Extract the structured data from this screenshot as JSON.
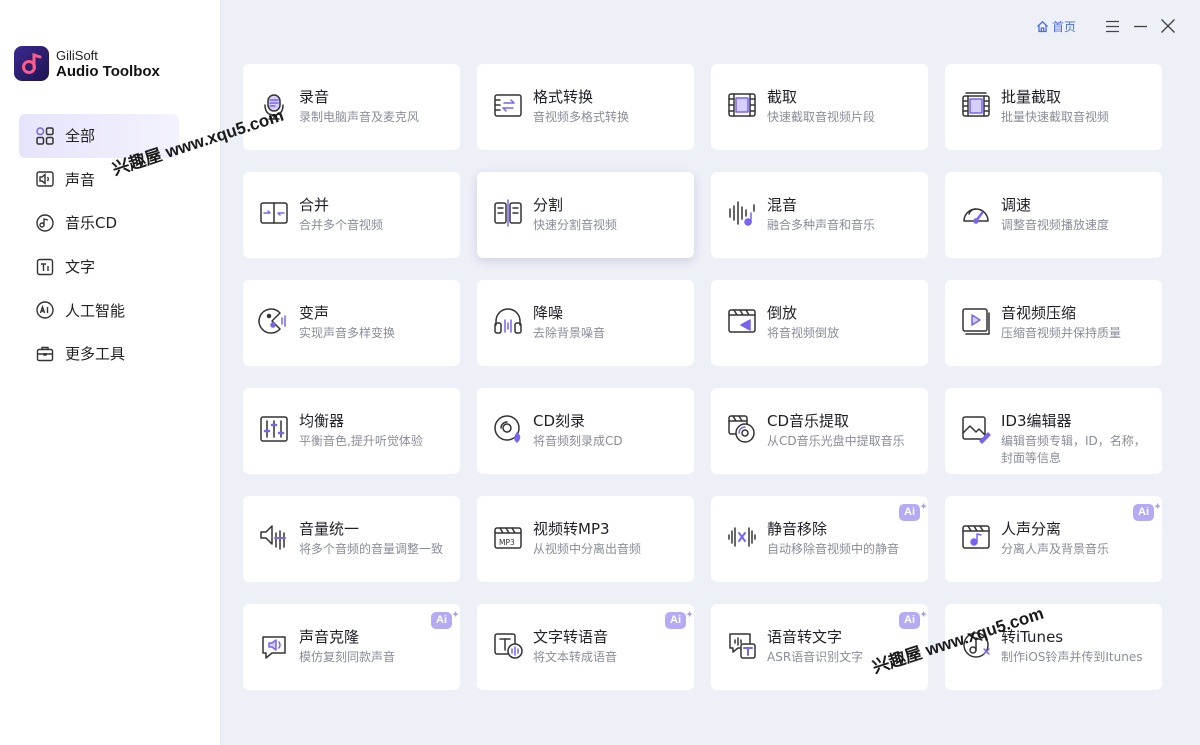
{
  "app": {
    "brand_line1": "GiliSoft",
    "brand_line2": "Audio Toolbox"
  },
  "topbar": {
    "home_label": "首页"
  },
  "sidebar": {
    "items": [
      {
        "label": "全部",
        "icon": "grid-icon",
        "active": true
      },
      {
        "label": "声音",
        "icon": "speaker-icon"
      },
      {
        "label": "音乐CD",
        "icon": "music-cd-icon"
      },
      {
        "label": "文字",
        "icon": "text-icon"
      },
      {
        "label": "人工智能",
        "icon": "ai-icon"
      },
      {
        "label": "更多工具",
        "icon": "toolbox-icon"
      }
    ]
  },
  "tools": [
    {
      "title": "录音",
      "desc": "录制电脑声音及麦克风",
      "icon": "microphone-icon"
    },
    {
      "title": "格式转换",
      "desc": "音视频多格式转换",
      "icon": "convert-icon"
    },
    {
      "title": "截取",
      "desc": "快速截取音视频片段",
      "icon": "film-trim-icon"
    },
    {
      "title": "批量截取",
      "desc": "批量快速截取音视频",
      "icon": "batch-trim-icon"
    },
    {
      "title": "合并",
      "desc": "合并多个音视频",
      "icon": "merge-icon"
    },
    {
      "title": "分割",
      "desc": "快速分割音视频",
      "icon": "split-icon"
    },
    {
      "title": "混音",
      "desc": "融合多种声音和音乐",
      "icon": "mix-icon"
    },
    {
      "title": "调速",
      "desc": "调整音视频播放速度",
      "icon": "speedometer-icon"
    },
    {
      "title": "变声",
      "desc": "实现声音多样变换",
      "icon": "voice-change-icon"
    },
    {
      "title": "降噪",
      "desc": "去除背景噪音",
      "icon": "headphones-icon"
    },
    {
      "title": "倒放",
      "desc": "将音视频倒放",
      "icon": "reverse-icon"
    },
    {
      "title": "音视频压缩",
      "desc": "压缩音视频并保持质量",
      "icon": "compress-icon"
    },
    {
      "title": "均衡器",
      "desc": "平衡音色,提升听觉体验",
      "icon": "equalizer-icon"
    },
    {
      "title": "CD刻录",
      "desc": "将音频刻录成CD",
      "icon": "cd-burn-icon"
    },
    {
      "title": "CD音乐提取",
      "desc": "从CD音乐光盘中提取音乐",
      "icon": "cd-rip-icon"
    },
    {
      "title": "ID3编辑器",
      "desc": "编辑音频专辑，ID，名称，封面等信息",
      "icon": "id3-edit-icon"
    },
    {
      "title": "音量统一",
      "desc": "将多个音频的音量调整一致",
      "icon": "volume-normalize-icon"
    },
    {
      "title": "视频转MP3",
      "desc": "从视频中分离出音频",
      "icon": "video-to-mp3-icon"
    },
    {
      "title": "静音移除",
      "desc": "自动移除音视频中的静音",
      "icon": "silence-remove-icon",
      "ai": "Ai"
    },
    {
      "title": "人声分离",
      "desc": "分离人声及背景音乐",
      "icon": "vocal-separate-icon",
      "ai": "Ai"
    },
    {
      "title": "声音克隆",
      "desc": "模仿复刻同款声音",
      "icon": "voice-clone-icon",
      "ai": "Ai"
    },
    {
      "title": "文字转语音",
      "desc": "将文本转成语音",
      "icon": "text-to-speech-icon",
      "ai": "Ai"
    },
    {
      "title": "语音转文字",
      "desc": "ASR语音识别文字",
      "icon": "speech-to-text-icon",
      "ai": "Ai"
    },
    {
      "title": "转iTunes",
      "desc": "制作iOS铃声并传到Itunes",
      "icon": "itunes-icon"
    }
  ],
  "watermarks": [
    "兴趣屋 www.xqu5.com",
    "兴趣屋 www.xqu5.com"
  ],
  "colors": {
    "accent": "#6b55e0",
    "icon_stroke": "#333333",
    "ai_badge": "#b6aaf3",
    "background": "#eef0f8"
  }
}
